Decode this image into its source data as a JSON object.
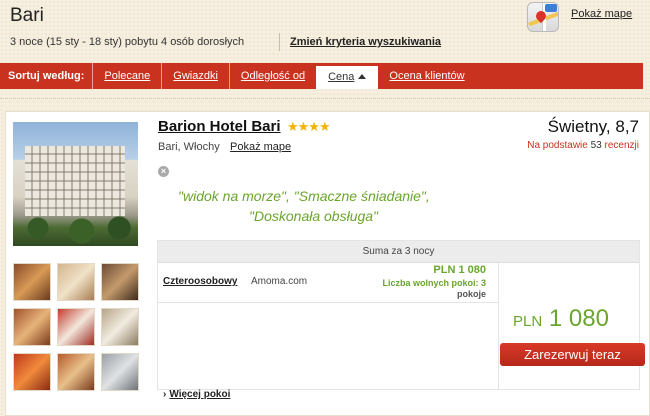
{
  "header": {
    "city": "Bari",
    "stay_info": "3 noce (15 sty - 18 sty) pobytu 4 osób dorosłych",
    "change_criteria": "Zmień kryteria wyszukiwania",
    "show_map": "Pokaż mape"
  },
  "sortbar": {
    "label": "Sortuj według:",
    "items": [
      {
        "label": "Polecane",
        "active": false
      },
      {
        "label": "Gwiazdki",
        "active": false
      },
      {
        "label": "Odległość od",
        "active": false
      },
      {
        "label": "Cena",
        "active": true
      },
      {
        "label": "Ocena klientów",
        "active": false
      }
    ]
  },
  "hotel": {
    "name": "Barion Hotel Bari",
    "stars": "★★★★",
    "star_count": 4,
    "location": "Bari, Włochy",
    "show_map": "Pokaż mape",
    "rating_word": "Świetny, 8,7",
    "rating_prefix": "Na podstawie",
    "review_count": "53",
    "rating_suffix": "recenzji",
    "quote_line1": "\"widok na morze\",  \"Smaczne śniadanie\",",
    "quote_line2": "\"Doskonała obsługa\"",
    "thumbnails": [
      "room-photo",
      "room-photo",
      "room-photo",
      "room-photo",
      "room-photo",
      "room-photo",
      "room-photo",
      "room-photo",
      "room-photo"
    ]
  },
  "rooms": {
    "header": "Suma za 3 nocy",
    "items": [
      {
        "name": "Czteroosobowy",
        "provider": "Amoma.com",
        "price": "PLN 1 080",
        "availability_label": "Liczba wolnych pokoi: 3",
        "availability_unit": "pokoje"
      }
    ],
    "total_currency": "PLN",
    "total_amount": "1 080",
    "book_button": "Zarezerwuj teraz",
    "more_rooms": "Więcej pokoi"
  },
  "colors": {
    "accent_red": "#c8321f",
    "price_green": "#6aa52e",
    "star_gold": "#f0b400"
  }
}
